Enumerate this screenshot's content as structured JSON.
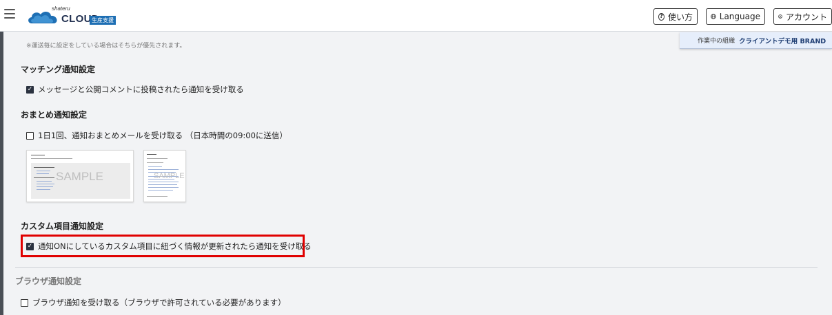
{
  "header": {
    "logo_small": "shateru",
    "logo_main": "CLOUD",
    "logo_badge": "生産支援",
    "help_label": "使い方",
    "language_label": "Language",
    "account_label": "アカウント"
  },
  "org": {
    "label": "作業中の組織",
    "name": "クライアントデモ用 BRAND"
  },
  "note": "※運送毎に設定をしている場合はそちらが優先されます。",
  "sections": {
    "matching": {
      "title": "マッチング通知設定",
      "option": "メッセージと公開コメントに投稿されたら通知を受け取る",
      "checked": true
    },
    "digest": {
      "title": "おまとめ通知設定",
      "option": "1日1回、通知おまとめメールを受け取る （日本時間の09:00に送信）",
      "checked": false,
      "sample_label": "SAMPLE"
    },
    "custom": {
      "title": "カスタム項目通知設定",
      "option": "通知ONにしているカスタム項目に紐づく情報が更新されたら通知を受け取る",
      "checked": true
    },
    "browser": {
      "title": "ブラウザ通知設定",
      "option": "ブラウザ通知を受け取る（ブラウザで許可されている必要があります）",
      "checked": false
    }
  },
  "colors": {
    "highlight": "#e00000",
    "brand": "#1e6fb4",
    "background": "#f2f3f5"
  }
}
